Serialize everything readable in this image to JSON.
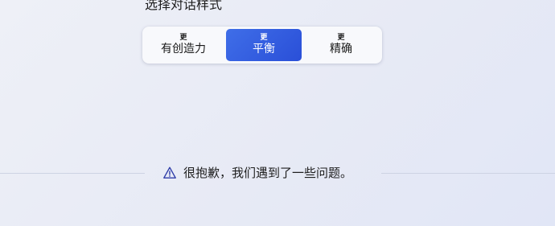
{
  "conversation_style": {
    "heading": "选择对话样式",
    "options": [
      {
        "prefix": "更",
        "label": "有创造力",
        "selected": false
      },
      {
        "prefix": "更",
        "label": "平衡",
        "selected": true
      },
      {
        "prefix": "更",
        "label": "精确",
        "selected": false
      }
    ]
  },
  "error": {
    "icon": "warning-icon",
    "message": "很抱歉，我们遇到了一些问题。"
  },
  "colors": {
    "selected_bg": "#2a4fd8",
    "warning_icon": "#2f3da8"
  }
}
